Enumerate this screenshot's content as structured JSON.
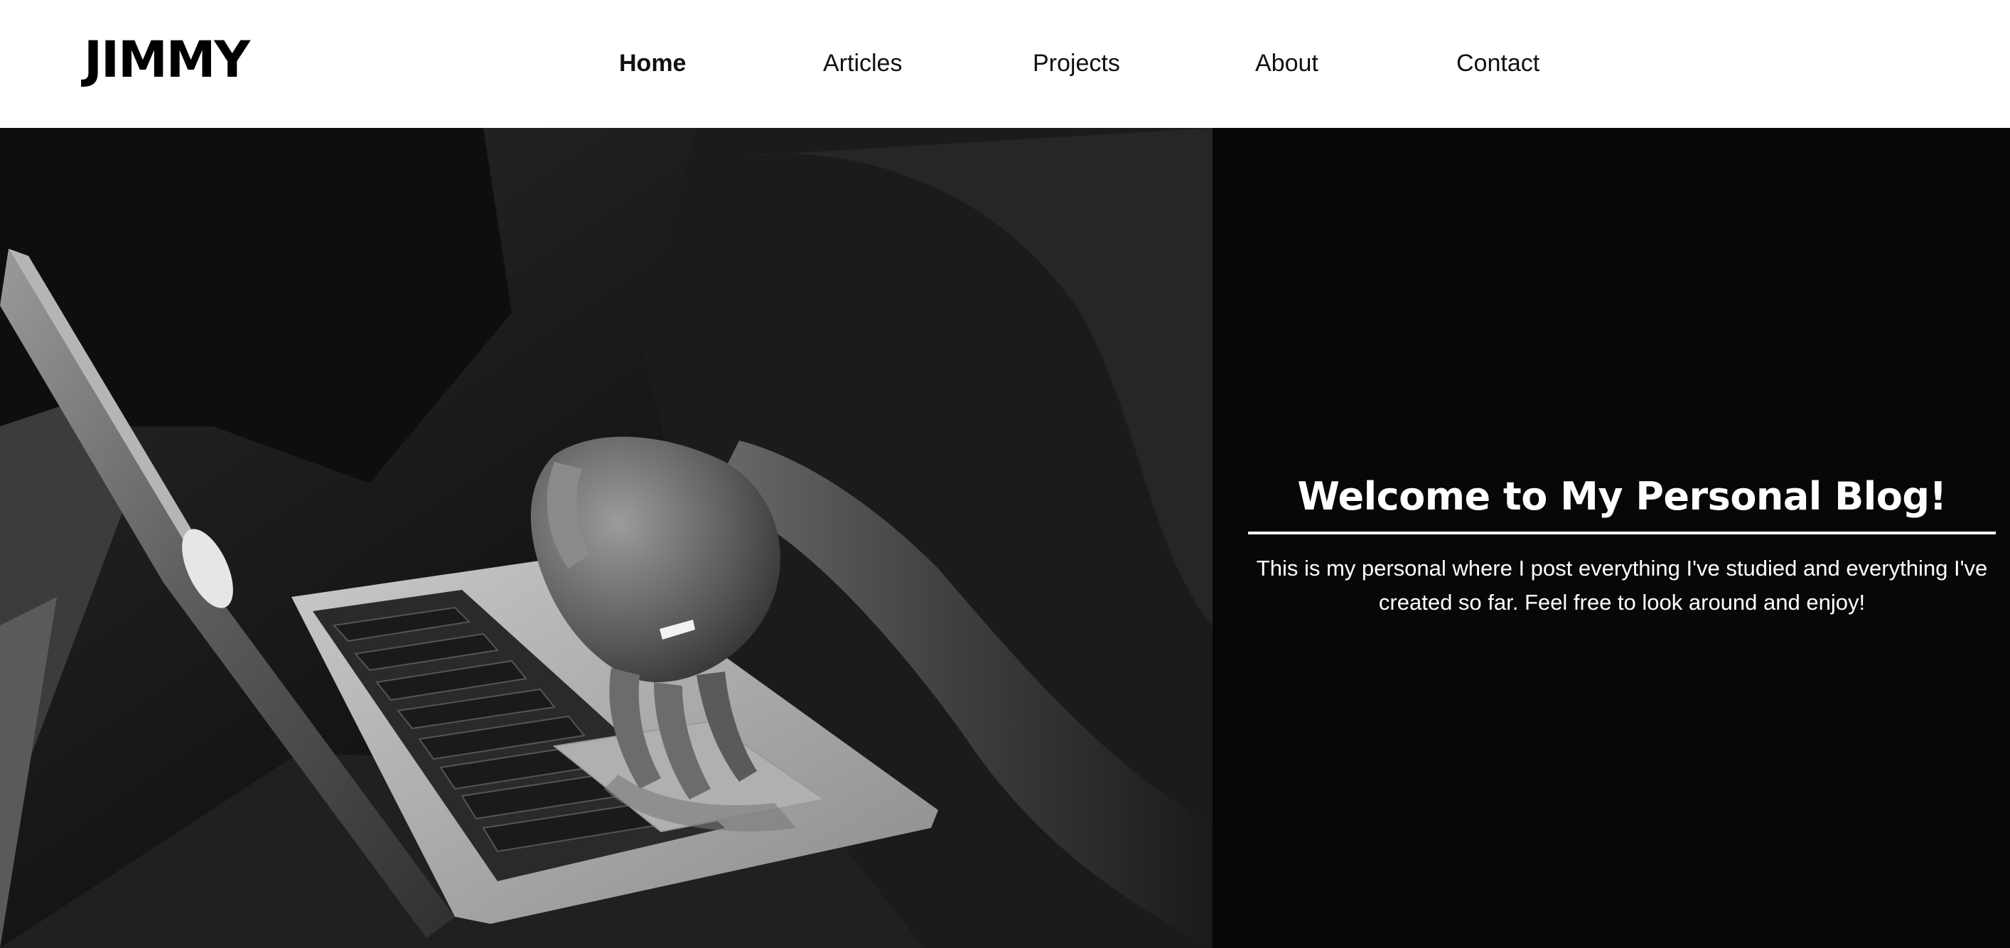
{
  "header": {
    "logo": "JIMMY",
    "nav": [
      {
        "label": "Home",
        "active": true
      },
      {
        "label": "Articles",
        "active": false
      },
      {
        "label": "Projects",
        "active": false
      },
      {
        "label": "About",
        "active": false
      },
      {
        "label": "Contact",
        "active": false
      }
    ]
  },
  "hero": {
    "image_icon": "laptop-photo",
    "title": "Welcome to My Personal Blog!",
    "description": "This is my personal where I post everything I've studied and everything I've created so far. Feel free to look around and enjoy!"
  },
  "colors": {
    "header_bg": "#ffffff",
    "hero_bg": "#070707",
    "text_dark": "#111111",
    "text_light": "#ffffff"
  }
}
